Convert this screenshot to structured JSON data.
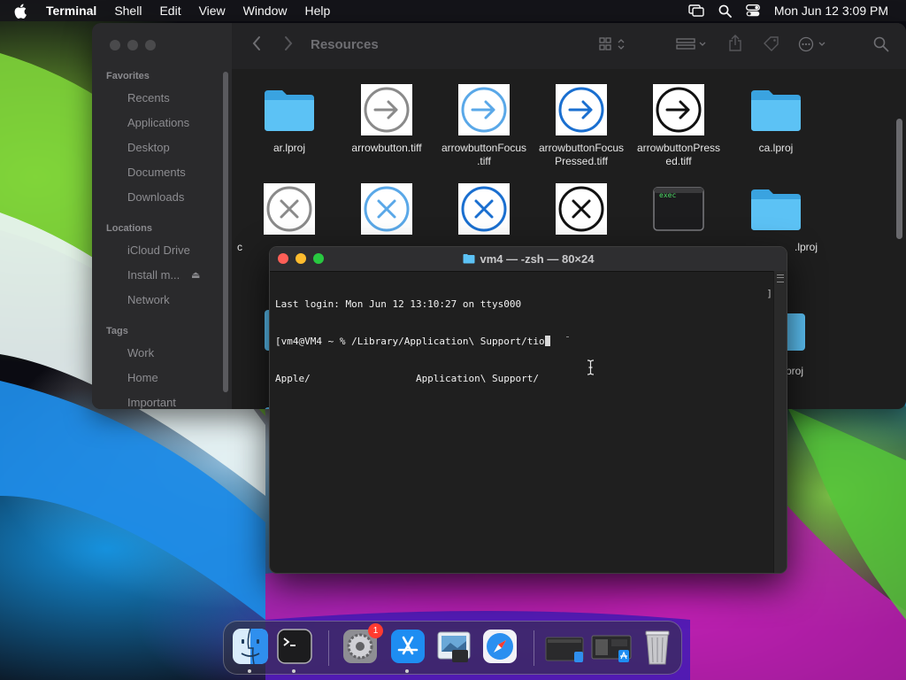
{
  "menubar": {
    "items": [
      "Terminal",
      "Shell",
      "Edit",
      "View",
      "Window",
      "Help"
    ],
    "clock": "Mon Jun 12  3:09 PM"
  },
  "finder": {
    "title": "Resources",
    "sidebar": {
      "favorites_header": "Favorites",
      "favorites": [
        "Recents",
        "Applications",
        "Desktop",
        "Documents",
        "Downloads"
      ],
      "locations_header": "Locations",
      "locations": [
        "iCloud Drive",
        "Install m...",
        "Network"
      ],
      "tags_header": "Tags",
      "tags": [
        "Work",
        "Home",
        "Important"
      ]
    },
    "files": [
      {
        "name": "ar.lproj",
        "kind": "folder"
      },
      {
        "name": "arrowbutton.tiff",
        "kind": "arrow-gray"
      },
      {
        "name": "arrowbuttonFocus\n.tiff",
        "kind": "arrow-lightblue"
      },
      {
        "name": "arrowbuttonFocus\nPressed.tiff",
        "kind": "arrow-blue"
      },
      {
        "name": "arrowbuttonPress\ned.tiff",
        "kind": "arrow-black"
      },
      {
        "name": "ca.lproj",
        "kind": "folder"
      },
      {
        "name": "c",
        "kind": "x-gray"
      },
      {
        "name": "",
        "kind": "x-lightblue"
      },
      {
        "name": "",
        "kind": "x-blue"
      },
      {
        "name": "",
        "kind": "x-black"
      },
      {
        "name": "",
        "kind": "exec"
      },
      {
        "name": ".lproj",
        "kind": "folder"
      }
    ],
    "partial_labels": [
      ".lproj"
    ],
    "exec_label": "exec"
  },
  "terminal": {
    "title": "vm4 — -zsh — 80×24",
    "lines": [
      "Last login: Mon Jun 12 13:10:27 on ttys000",
      "[vm4@VM4 ~ % /Library/Application\\ Support/tio",
      "Apple/                  Application\\ Support/"
    ],
    "bracket": "]"
  },
  "dock": {
    "apps": [
      "finder-icon",
      "terminal-icon",
      "system-settings-icon",
      "app-store-icon",
      "preview-icon",
      "safari-icon",
      "downloads-stack-icon",
      "documents-stack-icon",
      "trash-icon"
    ],
    "settings_badge": "1"
  },
  "colors": {
    "close": "#ff5f57",
    "minimize": "#febc2e",
    "zoom": "#28c840",
    "folder": "#47b2f0"
  }
}
